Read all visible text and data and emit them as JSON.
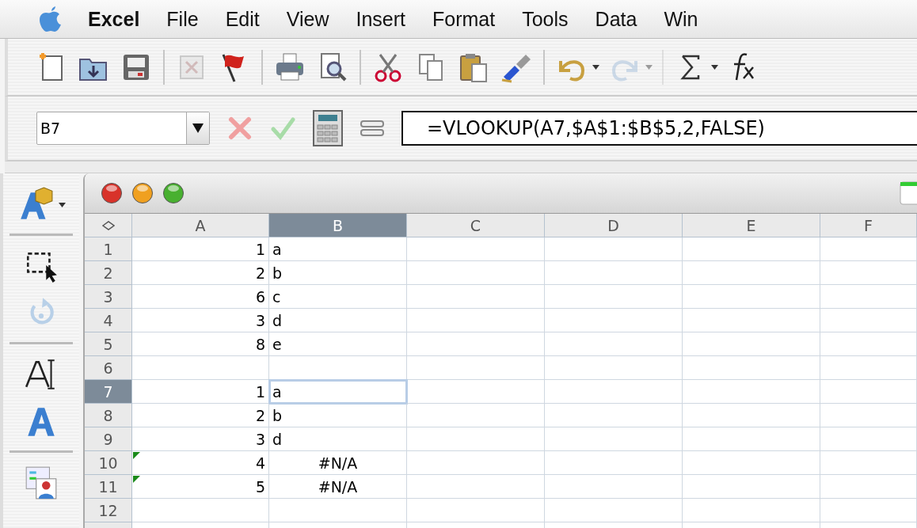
{
  "menu_bar": {
    "items": [
      {
        "label": "Excel",
        "kind": "app"
      },
      {
        "label": "File",
        "kind": "menu"
      },
      {
        "label": "Edit",
        "kind": "menu"
      },
      {
        "label": "View",
        "kind": "menu"
      },
      {
        "label": "Insert",
        "kind": "menu"
      },
      {
        "label": "Format",
        "kind": "menu"
      },
      {
        "label": "Tools",
        "kind": "menu"
      },
      {
        "label": "Data",
        "kind": "menu"
      },
      {
        "label": "Win",
        "kind": "menu"
      }
    ]
  },
  "toolbar": {
    "buttons": [
      {
        "disabled": false,
        "menu": false,
        "divider_after": false
      },
      {
        "disabled": false,
        "menu": false,
        "divider_after": false
      },
      {
        "disabled": false,
        "menu": false,
        "divider_after": true
      },
      {
        "disabled": true,
        "menu": false,
        "divider_after": false
      },
      {
        "disabled": false,
        "menu": false,
        "divider_after": true
      },
      {
        "disabled": false,
        "menu": false,
        "divider_after": false
      },
      {
        "disabled": false,
        "menu": false,
        "divider_after": true
      },
      {
        "disabled": false,
        "menu": false,
        "divider_after": false
      },
      {
        "disabled": false,
        "menu": false,
        "divider_after": false
      },
      {
        "disabled": false,
        "menu": false,
        "divider_after": false
      },
      {
        "disabled": false,
        "menu": false,
        "divider_after": true
      },
      {
        "disabled": false,
        "menu": true,
        "divider_after": false
      },
      {
        "disabled": true,
        "menu": true,
        "divider_after": true
      },
      {
        "disabled": false,
        "menu": true,
        "divider_after": false
      },
      {
        "disabled": false,
        "menu": false,
        "divider_after": false
      }
    ]
  },
  "formula_bar": {
    "name_box": "B7",
    "formula": "=VLOOKUP(A7,$A$1:$B$5,2,FALSE)"
  },
  "sheet": {
    "columns": [
      {
        "label": "A",
        "selected": false
      },
      {
        "label": "B",
        "selected": true
      },
      {
        "label": "C",
        "selected": false
      },
      {
        "label": "D",
        "selected": false
      },
      {
        "label": "E",
        "selected": false
      },
      {
        "label": "F",
        "selected": false
      }
    ],
    "rows": [
      {
        "label": "1",
        "selected": false,
        "cells": [
          {
            "text": "1",
            "kind": "number",
            "warning": false,
            "selected": false
          },
          {
            "text": "a",
            "kind": "text",
            "warning": false,
            "selected": false
          }
        ]
      },
      {
        "label": "2",
        "selected": false,
        "cells": [
          {
            "text": "2",
            "kind": "number",
            "warning": false,
            "selected": false
          },
          {
            "text": "b",
            "kind": "text",
            "warning": false,
            "selected": false
          }
        ]
      },
      {
        "label": "3",
        "selected": false,
        "cells": [
          {
            "text": "6",
            "kind": "number",
            "warning": false,
            "selected": false
          },
          {
            "text": "c",
            "kind": "text",
            "warning": false,
            "selected": false
          }
        ]
      },
      {
        "label": "4",
        "selected": false,
        "cells": [
          {
            "text": "3",
            "kind": "number",
            "warning": false,
            "selected": false
          },
          {
            "text": "d",
            "kind": "text",
            "warning": false,
            "selected": false
          }
        ]
      },
      {
        "label": "5",
        "selected": false,
        "cells": [
          {
            "text": "8",
            "kind": "number",
            "warning": false,
            "selected": false
          },
          {
            "text": "e",
            "kind": "text",
            "warning": false,
            "selected": false
          }
        ]
      },
      {
        "label": "6",
        "selected": false,
        "cells": []
      },
      {
        "label": "7",
        "selected": true,
        "cells": [
          {
            "text": "1",
            "kind": "number",
            "warning": false,
            "selected": false
          },
          {
            "text": "a",
            "kind": "text",
            "warning": false,
            "selected": true
          }
        ]
      },
      {
        "label": "8",
        "selected": false,
        "cells": [
          {
            "text": "2",
            "kind": "number",
            "warning": false,
            "selected": false
          },
          {
            "text": "b",
            "kind": "text",
            "warning": false,
            "selected": false
          }
        ]
      },
      {
        "label": "9",
        "selected": false,
        "cells": [
          {
            "text": "3",
            "kind": "number",
            "warning": false,
            "selected": false
          },
          {
            "text": "d",
            "kind": "text",
            "warning": false,
            "selected": false
          }
        ]
      },
      {
        "label": "10",
        "selected": false,
        "cells": [
          {
            "text": "4",
            "kind": "number",
            "warning": true,
            "selected": false
          },
          {
            "text": "#N/A",
            "kind": "error",
            "warning": false,
            "selected": false
          }
        ]
      },
      {
        "label": "11",
        "selected": false,
        "cells": [
          {
            "text": "5",
            "kind": "number",
            "warning": true,
            "selected": false
          },
          {
            "text": "#N/A",
            "kind": "error",
            "warning": false,
            "selected": false
          }
        ]
      },
      {
        "label": "12",
        "selected": false,
        "cells": []
      }
    ]
  }
}
